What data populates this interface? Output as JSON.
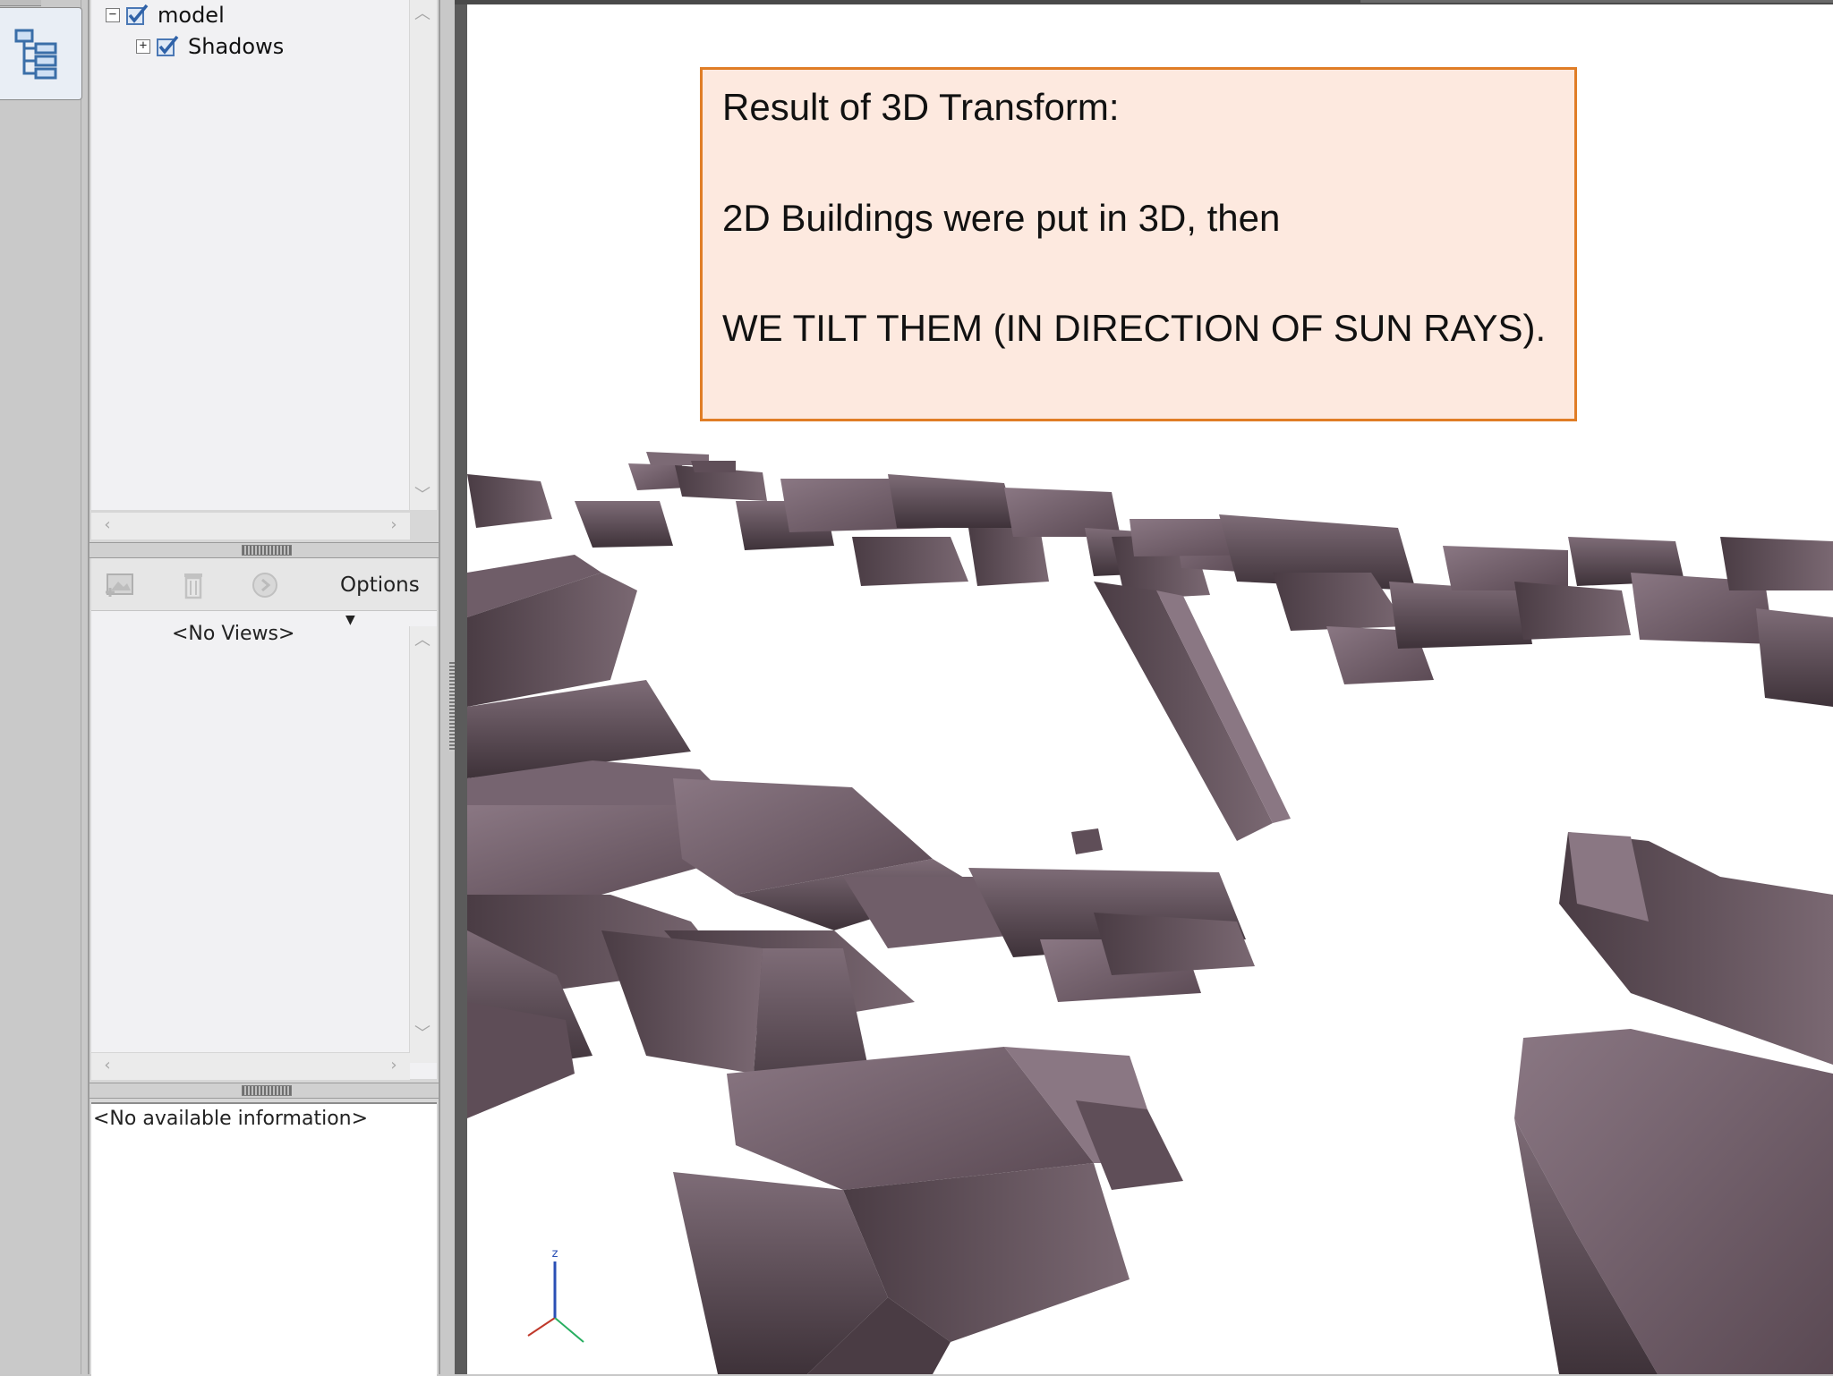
{
  "tree": {
    "items": [
      {
        "label": "model",
        "expander": "−",
        "checked": true
      },
      {
        "label": "Shadows",
        "expander": "+",
        "checked": true
      }
    ]
  },
  "views": {
    "toolbar": {
      "options_label": "Options"
    },
    "empty_label": "<No Views>"
  },
  "info": {
    "empty_label": "<No available information>"
  },
  "callout": {
    "line1": "Result of 3D Transform:",
    "line2": "2D Buildings were put in 3D, then",
    "line3": "WE TILT THEM (IN DIRECTION OF SUN RAYS)."
  },
  "viewport": {
    "axis_label": "z",
    "colors": {
      "building": "#6c5a66",
      "building_dark": "#3e3239",
      "building_light": "#8a7783",
      "callout_border": "#e07d26",
      "callout_fill": "#fde9df"
    }
  }
}
